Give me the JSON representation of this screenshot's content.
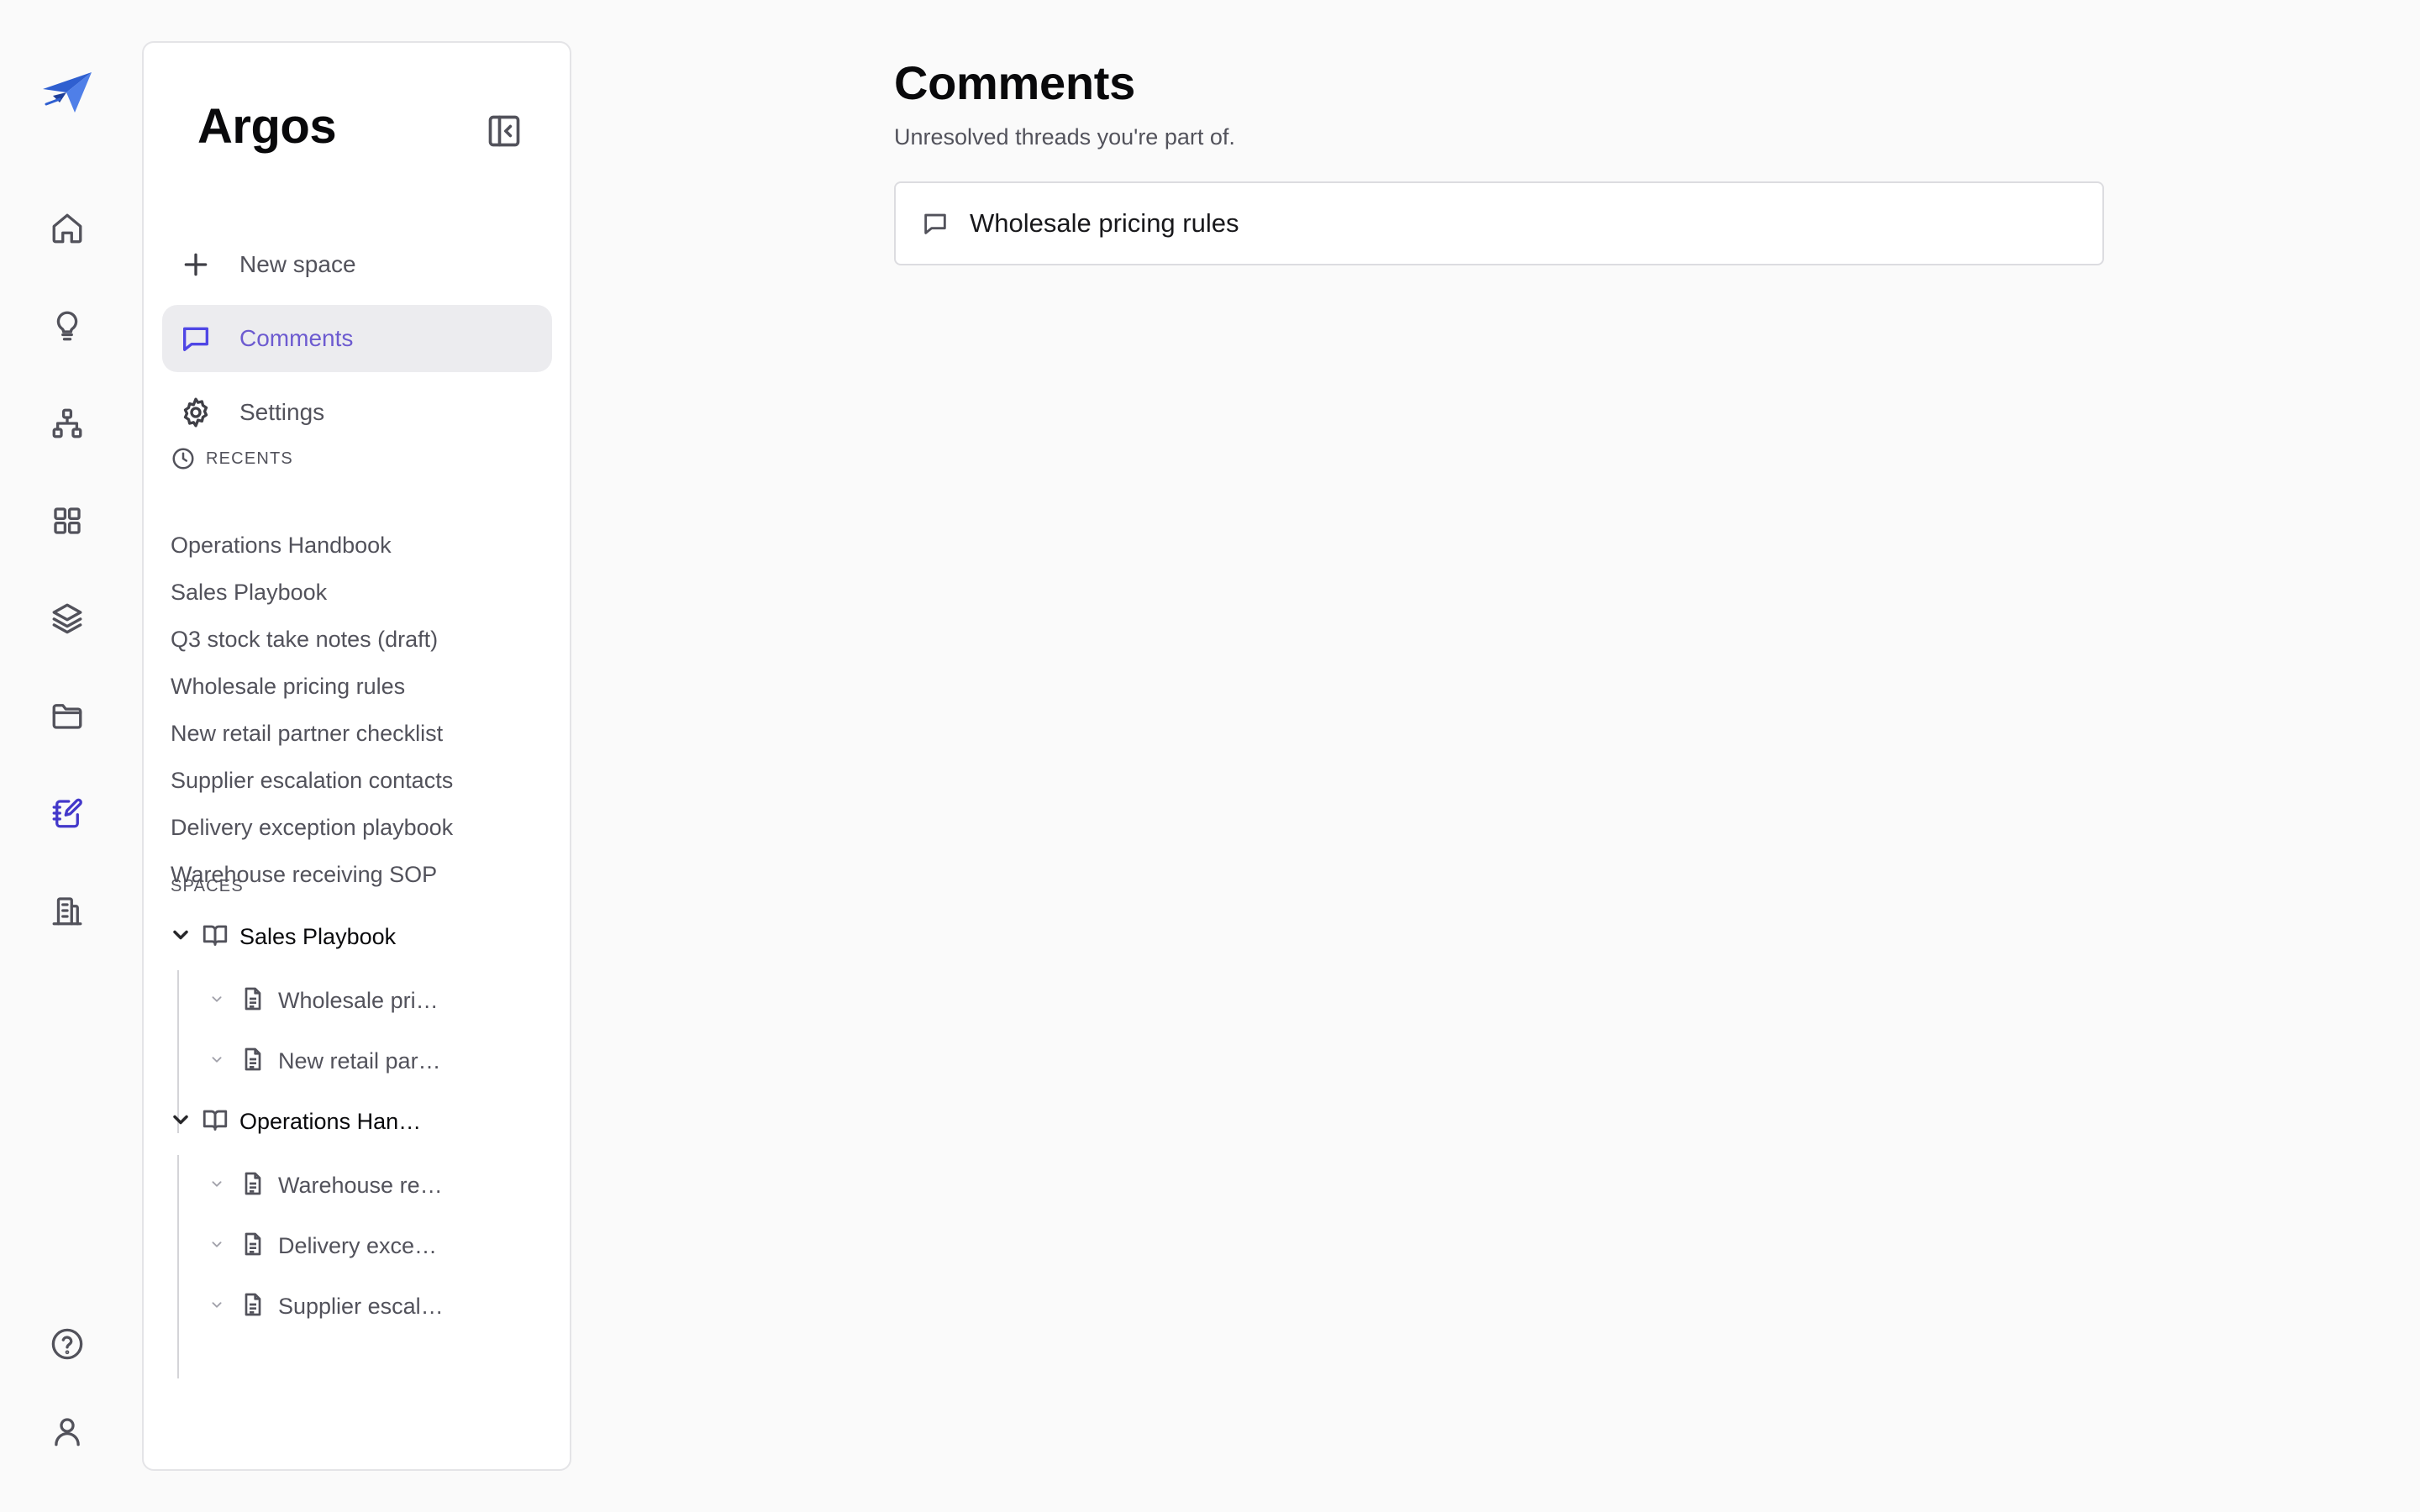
{
  "app": {
    "name": "Argos",
    "accent_color": "#4f46e5",
    "active_label_color": "#6d5bd0"
  },
  "rail": {
    "logo": "paper-plane-logo",
    "items": [
      {
        "icon": "home-icon"
      },
      {
        "icon": "lightbulb-icon"
      },
      {
        "icon": "sitemap-icon"
      },
      {
        "icon": "grid-icon"
      },
      {
        "icon": "layers-icon"
      },
      {
        "icon": "folder-icon"
      },
      {
        "icon": "notebook-edit-icon",
        "active": true
      },
      {
        "icon": "building-icon"
      }
    ],
    "bottom": [
      {
        "icon": "help-circle-icon"
      },
      {
        "icon": "user-icon"
      }
    ]
  },
  "sidebar": {
    "title": "Argos",
    "collapse_icon": "panel-collapse-icon",
    "nav": [
      {
        "label": "New space",
        "icon": "plus-icon"
      },
      {
        "label": "Comments",
        "icon": "message-square-icon",
        "active": true
      },
      {
        "label": "Settings",
        "icon": "gear-icon"
      }
    ],
    "recents_label": "RECENTS",
    "recents": [
      "Operations Handbook",
      "Sales Playbook",
      "Q3 stock take notes (draft)",
      "Wholesale pricing rules",
      "New retail partner checklist",
      "Supplier escalation contacts",
      "Delivery exception playbook",
      "Warehouse receiving SOP"
    ],
    "spaces_label": "SPACES",
    "spaces": [
      {
        "label": "Sales Playbook",
        "pages": [
          "Wholesale pri…",
          "New retail par…"
        ]
      },
      {
        "label": "Operations Han…",
        "pages": [
          "Warehouse re…",
          "Delivery exce…",
          "Supplier escal…"
        ]
      }
    ]
  },
  "main": {
    "title": "Comments",
    "subtitle": "Unresolved threads you're part of.",
    "threads": [
      {
        "label": "Wholesale pricing rules",
        "icon": "message-square-icon"
      }
    ]
  }
}
